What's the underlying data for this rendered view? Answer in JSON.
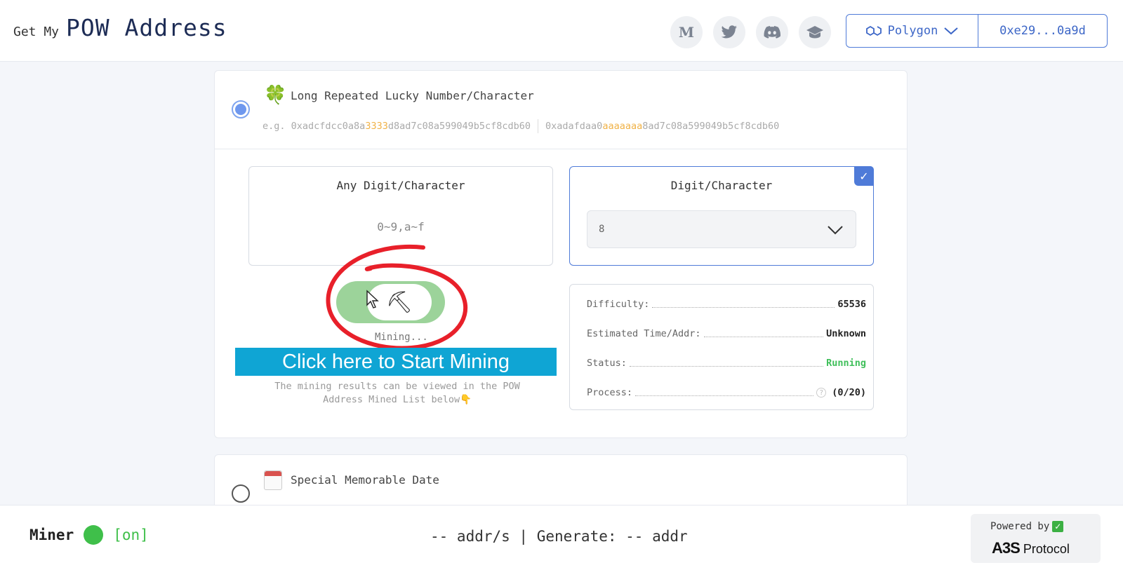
{
  "header": {
    "brand_small": "Get My",
    "brand_big": "POW Address",
    "social": {
      "medium": "M"
    },
    "network": "Polygon",
    "wallet": "0xe29...0a9d"
  },
  "option1": {
    "title": "Long Repeated Lucky Number/Character",
    "example1": {
      "prefix": "e.g. 0xadcfdcc0a8a",
      "highlight": "3333",
      "suffix": "d8ad7c08a599049b5cf8cdb60"
    },
    "example2": {
      "prefix": "0xadafdaa0",
      "highlight": "aaaaaaa",
      "suffix": "8ad7c08a599049b5cf8cdb60"
    },
    "any_box": {
      "title": "Any Digit/Character",
      "value": "0~9,a~f"
    },
    "digit_box": {
      "title": "Digit/Character",
      "selected": "8"
    },
    "mining_label": "Mining...",
    "cta": "Click here to Start Mining",
    "hint": "The mining results can be viewed in the POW Address Mined List below👇",
    "stats": {
      "difficulty_label": "Difficulty:",
      "difficulty": "65536",
      "time_label": "Estimated Time/Addr:",
      "time": "Unknown",
      "status_label": "Status:",
      "status": "Running",
      "process_label": "Process:",
      "process": "(0/20)"
    }
  },
  "option2": {
    "title": "Special Memorable Date"
  },
  "footer": {
    "miner_label": "Miner",
    "miner_state": "[on]",
    "rate": "-- addr/s | Generate: -- addr",
    "powered_by": "Powered by",
    "protocol": "Protocol",
    "logo_text": "A3S"
  },
  "colors": {
    "accent": "#4f7bd8",
    "green": "#3fbf4a",
    "cta": "#0fa5d4",
    "highlight": "#f0b247"
  }
}
